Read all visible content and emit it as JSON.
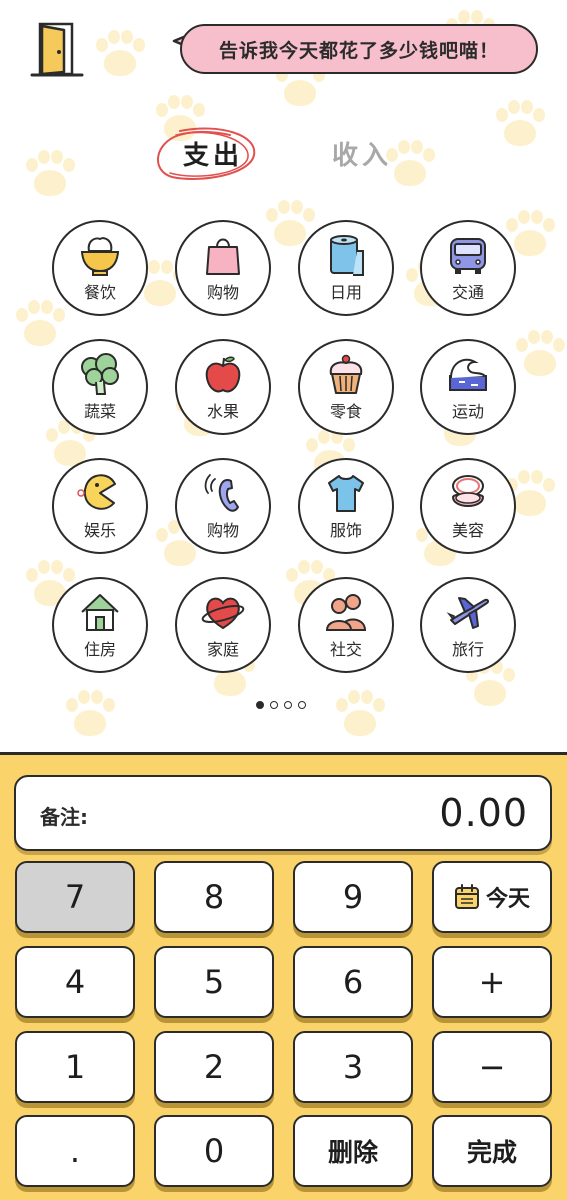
{
  "header": {
    "speech_bubble": "告诉我今天都花了多少钱吧喵！"
  },
  "tabs": [
    {
      "label": "支出",
      "active": true
    },
    {
      "label": "收入",
      "active": false
    }
  ],
  "categories": [
    {
      "label": "餐饮",
      "icon": "rice-bowl-icon"
    },
    {
      "label": "购物",
      "icon": "shopping-bag-icon"
    },
    {
      "label": "日用",
      "icon": "toilet-paper-icon"
    },
    {
      "label": "交通",
      "icon": "bus-icon"
    },
    {
      "label": "蔬菜",
      "icon": "broccoli-icon"
    },
    {
      "label": "水果",
      "icon": "apple-icon"
    },
    {
      "label": "零食",
      "icon": "cupcake-icon"
    },
    {
      "label": "运动",
      "icon": "wave-icon"
    },
    {
      "label": "娱乐",
      "icon": "pacman-icon"
    },
    {
      "label": "购物",
      "icon": "phone-icon"
    },
    {
      "label": "服饰",
      "icon": "tshirt-icon"
    },
    {
      "label": "美容",
      "icon": "compact-mirror-icon"
    },
    {
      "label": "住房",
      "icon": "house-icon"
    },
    {
      "label": "家庭",
      "icon": "heart-planet-icon"
    },
    {
      "label": "社交",
      "icon": "people-icon"
    },
    {
      "label": "旅行",
      "icon": "airplane-icon"
    }
  ],
  "pager": {
    "pages": 4,
    "current": 1
  },
  "memo": {
    "label": "备注:",
    "amount": "0.00"
  },
  "keys": {
    "k7": "7",
    "k8": "8",
    "k9": "9",
    "today": "今天",
    "k4": "4",
    "k5": "5",
    "k6": "6",
    "plus": "+",
    "k1": "1",
    "k2": "2",
    "k3": "3",
    "minus": "−",
    "dot": ".",
    "k0": "0",
    "delete": "删除",
    "done": "完成"
  },
  "colors": {
    "panel": "#fbd36b",
    "bubble": "#f7bfcc",
    "accent_red": "#e0514f",
    "paw": "#fdf0c8"
  }
}
